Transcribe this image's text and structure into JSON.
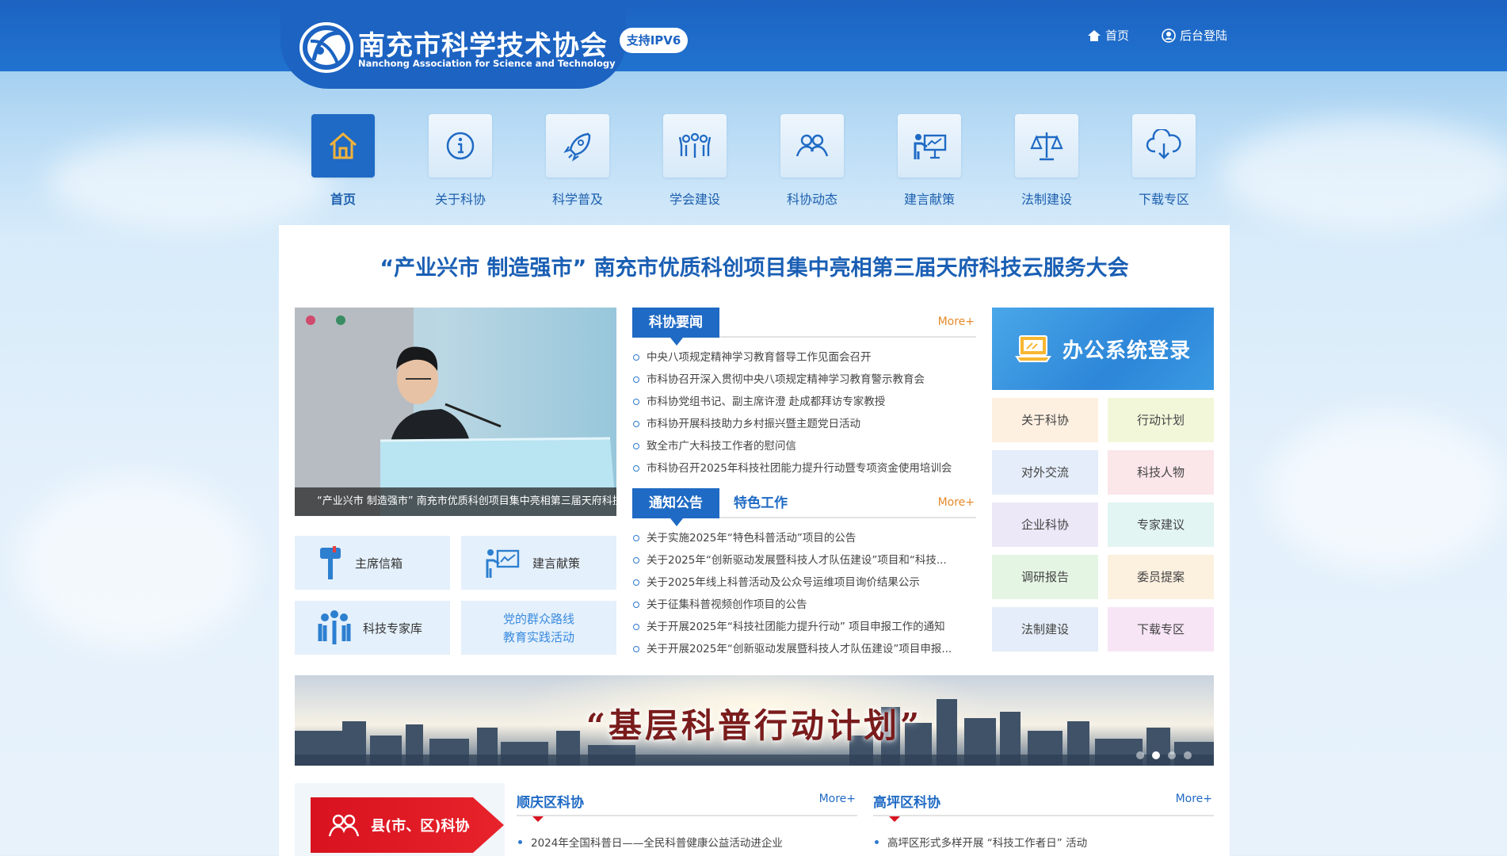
{
  "header": {
    "title_cn": "南充市科学技术协会",
    "title_en": "Nanchong  Association for Science and Technology",
    "ipv6_badge": "支持IPV6",
    "home_link": "首页",
    "login_link": "后台登陆"
  },
  "nav": {
    "items": [
      {
        "label": "首页",
        "icon": "home-icon"
      },
      {
        "label": "关于科协",
        "icon": "info-icon"
      },
      {
        "label": "科学普及",
        "icon": "rocket-icon"
      },
      {
        "label": "学会建设",
        "icon": "people-raise-icon"
      },
      {
        "label": "科协动态",
        "icon": "group-icon"
      },
      {
        "label": "建言献策",
        "icon": "presentation-icon"
      },
      {
        "label": "法制建设",
        "icon": "scale-icon"
      },
      {
        "label": "下载专区",
        "icon": "cloud-download-icon"
      }
    ]
  },
  "headline": "“产业兴市 制造强市”   南充市优质科创项目集中亮相第三届天府科技云服务大会",
  "slideshow": {
    "caption": "“产业兴市 制造强市”  南充市优质科创项目集中亮相第三届天府科技云服务大会"
  },
  "quick_links": {
    "mailbox": "主席信箱",
    "advice": "建言献策",
    "experts": "科技专家库",
    "mass_line_1": "党的群众路线",
    "mass_line_2": "教育实践活动"
  },
  "news": {
    "tab": "科协要闻",
    "more": "More+",
    "items": [
      "中央八项规定精神学习教育督导工作见面会召开",
      "市科协召开深入贯彻中央八项规定精神学习教育警示教育会",
      "市科协党组书记、副主席许澄 赴成都拜访专家教授",
      "市科协开展科技助力乡村振兴暨主题党日活动",
      "致全市广大科技工作者的慰问信",
      "市科协召开2025年科技社团能力提升行动暨专项资金使用培训会"
    ]
  },
  "notices": {
    "tab": "通知公告",
    "tab2": "特色工作",
    "more": "More+",
    "items": [
      "关于实施2025年“特色科普活动”项目的公告",
      "关于2025年“创新驱动发展暨科技人才队伍建设”项目和“科技...",
      "关于2025年线上科普活动及公众号运维项目询价结果公示",
      "关于征集科普视频创作项目的公告",
      "关于开展2025年“科技社团能力提升行动” 项目申报工作的通知",
      "关于开展2025年“创新驱动发展暨科技人才队伍建设”项目申报..."
    ]
  },
  "office": {
    "label": "办公系统登录"
  },
  "grid": {
    "items": [
      {
        "label": "关于科协",
        "bg": "#fdf0e1"
      },
      {
        "label": "行动计划",
        "bg": "#f3f7da"
      },
      {
        "label": "对外交流",
        "bg": "#e4edf9"
      },
      {
        "label": "科技人物",
        "bg": "#fbe6ea"
      },
      {
        "label": "企业科协",
        "bg": "#ede8f8"
      },
      {
        "label": "专家建议",
        "bg": "#e2f5f2"
      },
      {
        "label": "调研报告",
        "bg": "#e5f5e4"
      },
      {
        "label": "委员提案",
        "bg": "#fcf0df"
      },
      {
        "label": "法制建设",
        "bg": "#e4edf9"
      },
      {
        "label": "下载专区",
        "bg": "#f7e5f6"
      }
    ]
  },
  "banner": {
    "text": "“基层科普行动计划”"
  },
  "county": {
    "label": "县(市、区)科协",
    "left_title": "顺庆区科协",
    "left_more": "More+",
    "left_item": "2024年全国科普日——全民科普健康公益活动进企业",
    "right_title": "高坪区科协",
    "right_more": "More+",
    "right_item": "高坪区形式多样开展 “科技工作者日” 活动"
  },
  "colors": {
    "brand_blue": "#1f6ac4",
    "accent_orange": "#e58a2c",
    "county_red": "#d8121f"
  }
}
